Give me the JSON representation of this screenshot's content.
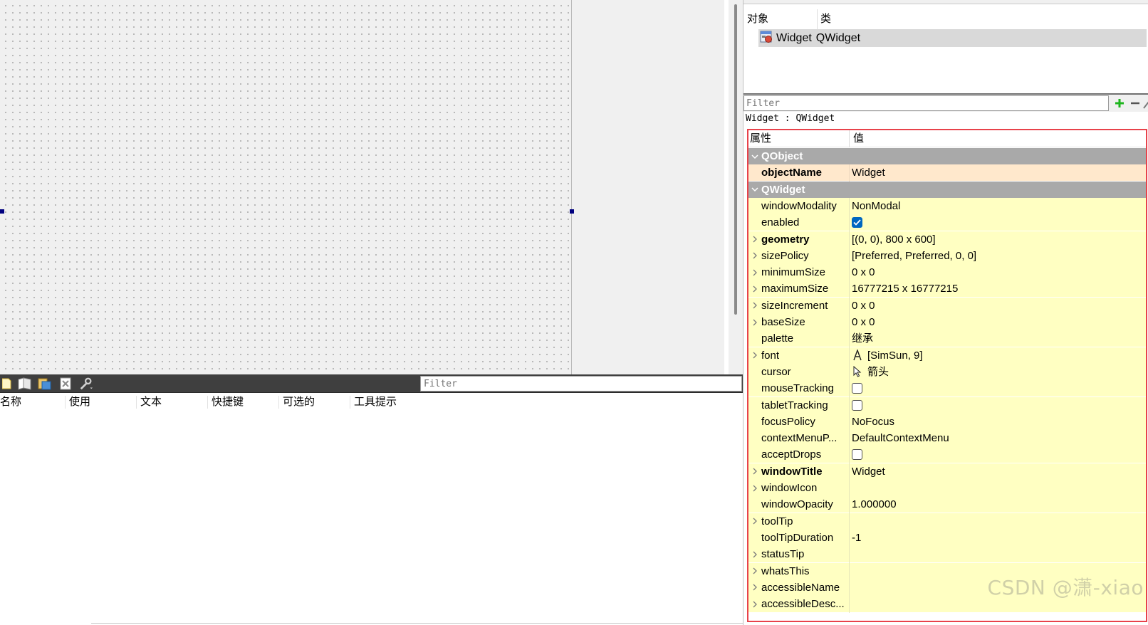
{
  "object_inspector": {
    "col_object": "对象",
    "col_class": "类",
    "rows": [
      {
        "name": "Widget",
        "class": "QWidget"
      }
    ]
  },
  "property_editor": {
    "filter_placeholder": "Filter",
    "context_label": "Widget : QWidget",
    "col_property": "属性",
    "col_value": "值",
    "groups": [
      {
        "name": "QObject",
        "expanded": true,
        "properties": [
          {
            "name": "objectName",
            "value": "Widget",
            "bold": true,
            "expandable": false,
            "kind": "text"
          }
        ]
      },
      {
        "name": "QWidget",
        "expanded": true,
        "properties": [
          {
            "name": "windowModality",
            "value": "NonModal",
            "bold": false,
            "expandable": false,
            "kind": "text"
          },
          {
            "name": "enabled",
            "value": "",
            "checked": true,
            "bold": false,
            "expandable": false,
            "kind": "checkbox"
          },
          {
            "name": "geometry",
            "value": "[(0, 0), 800 x 600]",
            "bold": true,
            "expandable": true,
            "kind": "text"
          },
          {
            "name": "sizePolicy",
            "value": "[Preferred, Preferred, 0, 0]",
            "bold": false,
            "expandable": true,
            "kind": "text"
          },
          {
            "name": "minimumSize",
            "value": "0 x 0",
            "bold": false,
            "expandable": true,
            "kind": "text"
          },
          {
            "name": "maximumSize",
            "value": "16777215 x 16777215",
            "bold": false,
            "expandable": true,
            "kind": "text"
          },
          {
            "name": "sizeIncrement",
            "value": "0 x 0",
            "bold": false,
            "expandable": true,
            "kind": "text"
          },
          {
            "name": "baseSize",
            "value": "0 x 0",
            "bold": false,
            "expandable": true,
            "kind": "text"
          },
          {
            "name": "palette",
            "value": "继承",
            "bold": false,
            "expandable": false,
            "kind": "text"
          },
          {
            "name": "font",
            "value": "[SimSun, 9]",
            "glyph": "font-icon",
            "bold": false,
            "expandable": true,
            "kind": "glyph"
          },
          {
            "name": "cursor",
            "value": "箭头",
            "glyph": "arrow-cursor-icon",
            "bold": false,
            "expandable": false,
            "kind": "glyph"
          },
          {
            "name": "mouseTracking",
            "value": "",
            "checked": false,
            "bold": false,
            "expandable": false,
            "kind": "checkbox"
          },
          {
            "name": "tabletTracking",
            "value": "",
            "checked": false,
            "bold": false,
            "expandable": false,
            "kind": "checkbox"
          },
          {
            "name": "focusPolicy",
            "value": "NoFocus",
            "bold": false,
            "expandable": false,
            "kind": "text"
          },
          {
            "name": "contextMenuP...",
            "value": "DefaultContextMenu",
            "bold": false,
            "expandable": false,
            "kind": "text"
          },
          {
            "name": "acceptDrops",
            "value": "",
            "checked": false,
            "bold": false,
            "expandable": false,
            "kind": "checkbox"
          },
          {
            "name": "windowTitle",
            "value": "Widget",
            "bold": true,
            "expandable": true,
            "kind": "text"
          },
          {
            "name": "windowIcon",
            "value": "",
            "bold": false,
            "expandable": true,
            "kind": "text"
          },
          {
            "name": "windowOpacity",
            "value": "1.000000",
            "bold": false,
            "expandable": false,
            "kind": "text"
          },
          {
            "name": "toolTip",
            "value": "",
            "bold": false,
            "expandable": true,
            "kind": "text"
          },
          {
            "name": "toolTipDuration",
            "value": "-1",
            "bold": false,
            "expandable": false,
            "kind": "text"
          },
          {
            "name": "statusTip",
            "value": "",
            "bold": false,
            "expandable": true,
            "kind": "text"
          },
          {
            "name": "whatsThis",
            "value": "",
            "bold": false,
            "expandable": true,
            "kind": "text"
          },
          {
            "name": "accessibleName",
            "value": "",
            "bold": false,
            "expandable": true,
            "kind": "text"
          },
          {
            "name": "accessibleDesc...",
            "value": "",
            "bold": false,
            "expandable": true,
            "kind": "text"
          }
        ]
      }
    ]
  },
  "action_editor": {
    "filter_placeholder": "Filter",
    "columns": [
      "名称",
      "使用",
      "文本",
      "快捷键",
      "可选的",
      "工具提示"
    ],
    "toolbar_icons": [
      "new-action-icon",
      "copy-action-icon",
      "paste-action-icon",
      "delete-action-icon",
      "configure-icon"
    ]
  },
  "watermark": "CSDN @潇-xiao",
  "colors": {
    "group_header": "#a9a9a9",
    "qobject_row": "#ffe8cc",
    "qwidget_row": "#ffffc2",
    "highlight_border": "#e8424b",
    "toolbar_bg": "#3f3f3f",
    "selection_handle": "#00007f",
    "checkbox_checked": "#0067c0"
  }
}
